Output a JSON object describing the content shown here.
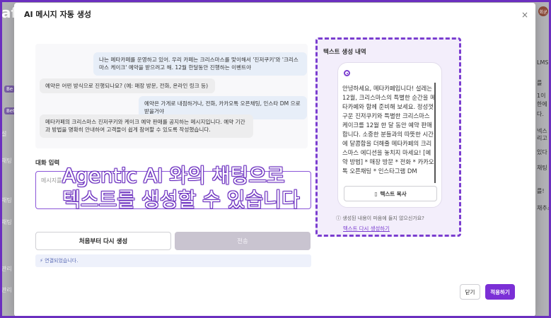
{
  "background": {
    "logo": "af",
    "left_items": [
      "Be",
      "Bet",
      "설",
      "채팅",
      "채팅",
      "채팅",
      "관리",
      "관리"
    ],
    "right_items": [
      "LMS",
      "를",
      "1이",
      "한에",
      "다.",
      "넥스",
      "리고",
      "있다",
      "채팅",
      "를!",
      "채추스"
    ],
    "avatar": "회균"
  },
  "modal": {
    "title": "AI 메시지 자동 생성",
    "close_symbol": "×"
  },
  "chat": {
    "messages": [
      {
        "role": "user",
        "text": "나는 메타카페를 운영하고 있어. 우리 카페는 크리스마스를 맞이해서 '진저쿠키'와 '크리스마스 케이크' 예약을 받으려고 해. 12월 한달동안 진행하는 이벤트야"
      },
      {
        "role": "ai",
        "text": "예약은 어떤 방식으로 진행되나요? (예: 매장 방문, 전화, 온라인 링크 등)"
      },
      {
        "role": "user",
        "text": "예약은 가게로 내점하거나, 전화, 카카오톡 오픈채팅, 인스타 DM 으로 받을거야"
      },
      {
        "role": "ai",
        "text": "메타카페의 크리스마스 진저쿠키와 케이크 예약 판매를 공지하는 메시지입니다. 예약 기간과 방법을 명확히 안내하여 고객들이 쉽게 참여할 수 있도록 작성했습니다."
      }
    ]
  },
  "input": {
    "label": "대화 입력",
    "placeholder": "메시지를"
  },
  "caption": {
    "line1": "Agentic AI 와의 채팅으로",
    "line2": "텍스트를 생성할 수 있습니다"
  },
  "buttons": {
    "reset": "처음부터 다시 생성",
    "send": "전송",
    "close": "닫기",
    "apply": "적용하기",
    "copy": "텍스트 복사"
  },
  "status": {
    "icon": "⚡",
    "text": "연결되었습니다."
  },
  "history": {
    "title": "텍스트 생성 내역",
    "generated_text": "안녕하세요, 메타카페입니다! 설레는 12월, 크리스마스의 특별한 순간을 메타카페와 함께 준비해 보세요. 정성껏 구운 진저쿠키와 특별한 크리스마스 케이크를 12월 한 달 동안 예약 판매합니다. 소중한 분들과의 따뜻한 시간에 달콤함을 더해줄 메타카페의 크리스마스 에디션을 놓치지 마세요! [예약 방법] * 매장 방문 * 전화 * 카카오톡 오픈채팅 * 인스타그램 DM",
    "hint": "생성된 내용이 마음에 들지 않으신가요?",
    "regenerate": "텍스트 다시 생성하기"
  }
}
